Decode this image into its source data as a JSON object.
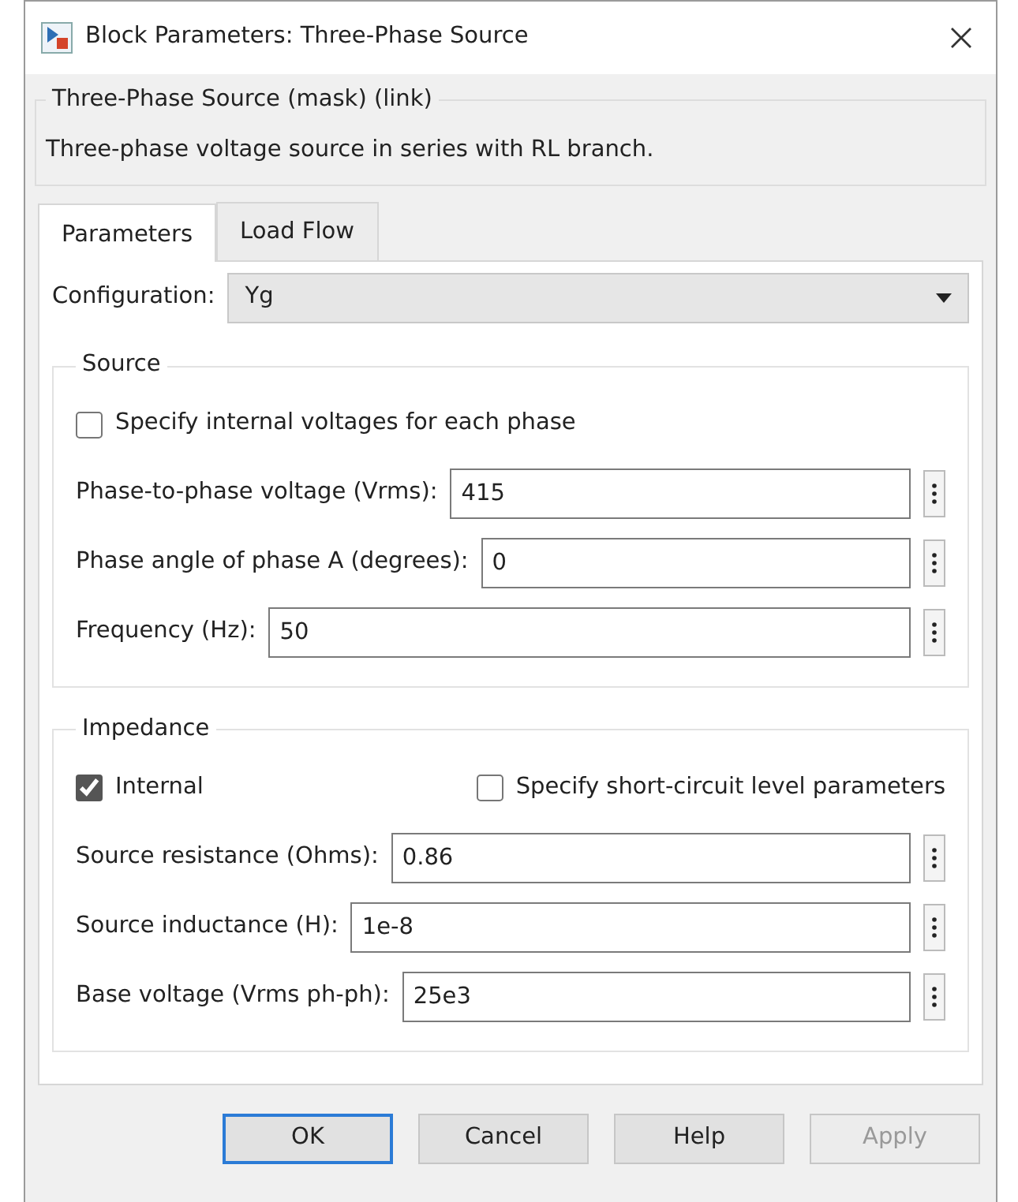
{
  "window": {
    "title": "Block Parameters: Three-Phase Source"
  },
  "header": {
    "group_title": "Three-Phase Source (mask) (link)",
    "description": "Three-phase voltage source in series with RL branch."
  },
  "tabs": [
    {
      "label": "Parameters",
      "selected": true
    },
    {
      "label": "Load Flow",
      "selected": false
    }
  ],
  "configuration": {
    "label": "Configuration:",
    "value": "Yg"
  },
  "sections": [
    {
      "title": "Source",
      "rows": [
        {
          "kind": "checkboxes",
          "items": [
            {
              "label": "Specify internal voltages for each phase",
              "checked": false
            }
          ]
        },
        {
          "kind": "field",
          "label": "Phase-to-phase voltage (Vrms):",
          "value": "415"
        },
        {
          "kind": "field",
          "label": "Phase angle of phase A (degrees):",
          "value": "0"
        },
        {
          "kind": "field",
          "label": "Frequency (Hz):",
          "value": "50"
        }
      ]
    },
    {
      "title": "Impedance",
      "rows": [
        {
          "kind": "checkboxes",
          "items": [
            {
              "label": "Internal",
              "checked": true
            },
            {
              "label": "Specify short-circuit level parameters",
              "checked": false
            }
          ]
        },
        {
          "kind": "field",
          "label": "Source resistance (Ohms):",
          "value": "0.86"
        },
        {
          "kind": "field",
          "label": "Source inductance (H):",
          "value": "1e-8"
        },
        {
          "kind": "field",
          "label": "Base voltage (Vrms ph-ph):",
          "value": "25e3"
        }
      ]
    }
  ],
  "buttons": [
    {
      "label": "OK",
      "default": true,
      "disabled": false
    },
    {
      "label": "Cancel",
      "default": false,
      "disabled": false
    },
    {
      "label": "Help",
      "default": false,
      "disabled": false
    },
    {
      "label": "Apply",
      "default": false,
      "disabled": true
    }
  ]
}
